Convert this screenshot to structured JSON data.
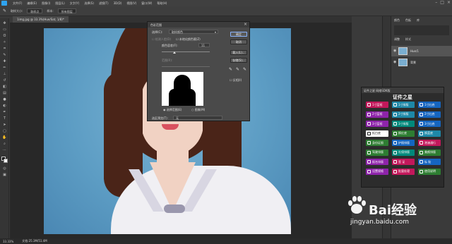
{
  "menu": {
    "items": [
      "文件(F)",
      "编辑(E)",
      "图像(I)",
      "图层(L)",
      "文字(Y)",
      "选择(S)",
      "滤镜(T)",
      "3D(D)",
      "视图(V)",
      "窗口(W)",
      "帮助(H)"
    ]
  },
  "window_controls": [
    "–",
    "□",
    "×"
  ],
  "options_bar": {
    "sample_label": "取样大小:",
    "sample_value": "取样点",
    "sample_all_label": "样本:",
    "sample_all_value": "所有图层"
  },
  "document_tab": "1img.jpg @ 33.3%(Hue/Sat, 1/8)*",
  "status_bar": {
    "zoom": "33.33%",
    "doc_size": "文档:25.3M/51.4M"
  },
  "dialog": {
    "title": "色彩范围",
    "select_label": "选择(C):",
    "select_value": "取样颜色",
    "detect_faces": "检测人脸(D)",
    "localized_clusters": "本地化颜色簇(Z)",
    "fuzziness_label": "颜色容差(F):",
    "fuzziness_value": "11",
    "range_label": "范围(R):",
    "ok": "确定",
    "cancel": "取消",
    "load": "载入(L)...",
    "save": "存储(S)...",
    "invert": "反相(I)",
    "radio_selection": "选择范围(E)",
    "radio_image": "图像(M)",
    "preview_label": "选区预览(T):",
    "preview_value": "无"
  },
  "right_panel": {
    "tabs": [
      "颜色",
      "色板",
      "库"
    ],
    "tabs2": [
      "调整",
      "样式"
    ],
    "layers": [
      {
        "name": "Hue/1"
      },
      {
        "name": "背景"
      }
    ]
  },
  "plugin": {
    "header": "证件之星 网络SDK版",
    "title": "证件之星",
    "buttons": [
      {
        "label": "1寸蓝框",
        "color": "#c2185b"
      },
      {
        "label": "1寸排版",
        "color": "#1e88a8"
      },
      {
        "label": "1寸红底",
        "color": "#1565c0"
      },
      {
        "label": "2寸蓝框",
        "color": "#8e24aa"
      },
      {
        "label": "2寸排版",
        "color": "#1e88a8"
      },
      {
        "label": "2寸红底",
        "color": "#1565c0"
      },
      {
        "label": "3寸蓝框",
        "color": "#8e24aa"
      },
      {
        "label": "3寸排版",
        "color": "#00897b"
      },
      {
        "label": "3寸红底",
        "color": "#1565c0"
      },
      {
        "label": "抠白底",
        "color": "#ffffff"
      },
      {
        "label": "换红底",
        "color": "#2e7d32"
      },
      {
        "label": "换蓝底",
        "color": "#1e88a8"
      },
      {
        "label": "身份证照",
        "color": "#2e7d32"
      },
      {
        "label": "护照排版",
        "color": "#1565c0"
      },
      {
        "label": "港澳通行",
        "color": "#c2185b"
      },
      {
        "label": "驾驶排版",
        "color": "#2e7d32"
      },
      {
        "label": "社保排版",
        "color": "#00897b"
      },
      {
        "label": "美颜排版",
        "color": "#2e7d32"
      },
      {
        "label": "报名排版",
        "color": "#8e24aa"
      },
      {
        "label": "签    证",
        "color": "#c2185b"
      },
      {
        "label": "标    贴",
        "color": "#1565c0"
      },
      {
        "label": "设置规格",
        "color": "#8e24aa"
      },
      {
        "label": "批量处理",
        "color": "#c2185b"
      },
      {
        "label": "使用说明",
        "color": "#2e7d32"
      }
    ]
  },
  "watermark": {
    "brand": "Bai",
    "brand2": "经验",
    "url": "jingyan.baidu.com"
  },
  "colors": {
    "background_blue": "#5d9dc4",
    "app_dark": "#3a3a3a"
  }
}
